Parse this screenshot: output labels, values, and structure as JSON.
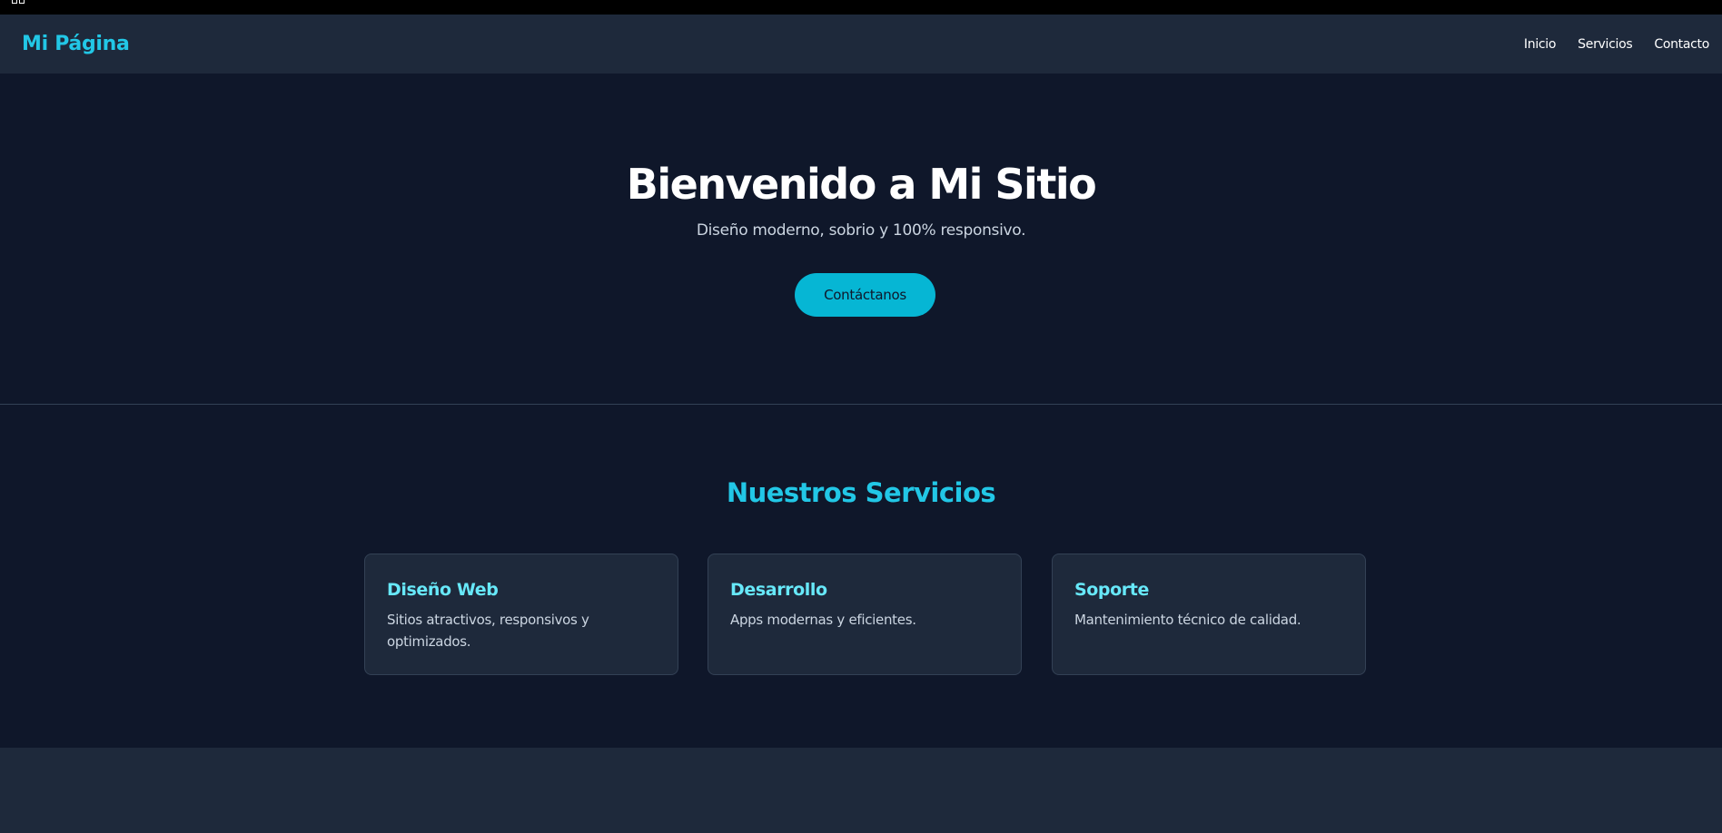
{
  "navbar": {
    "brand": "Mi Página",
    "links": [
      {
        "label": "Inicio"
      },
      {
        "label": "Servicios"
      },
      {
        "label": "Contacto"
      }
    ]
  },
  "hero": {
    "title": "Bienvenido a Mi Sitio",
    "subtitle": "Diseño moderno, sobrio y 100% responsivo.",
    "cta_label": "Contáctanos"
  },
  "services": {
    "title": "Nuestros Servicios",
    "cards": [
      {
        "title": "Diseño Web",
        "text": "Sitios atractivos, responsivos y optimizados."
      },
      {
        "title": "Desarrollo",
        "text": "Apps modernas y eficientes."
      },
      {
        "title": "Soporte",
        "text": "Mantenimiento técnico de calidad."
      }
    ]
  },
  "colors": {
    "accent": "#22c7e6",
    "button": "#06b6d4",
    "background": "#0f172a",
    "surface": "#1e293b"
  }
}
